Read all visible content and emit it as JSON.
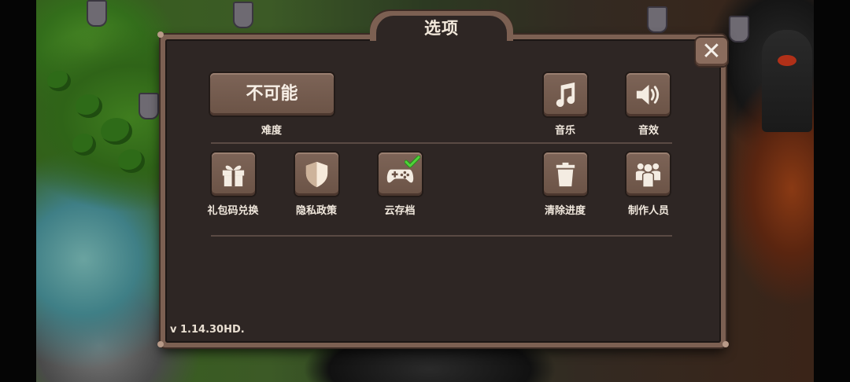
{
  "dialog": {
    "title": "选项",
    "version": "v 1.14.30HD."
  },
  "difficulty": {
    "value": "不可能",
    "label": "难度"
  },
  "audio": {
    "music_label": "音乐",
    "sound_label": "音效"
  },
  "buttons": [
    {
      "label": "礼包码兑换",
      "icon": "gift-icon"
    },
    {
      "label": "隐私政策",
      "icon": "shield-icon"
    },
    {
      "label": "云存档",
      "icon": "gamepad-check-icon"
    },
    {
      "label": "清除进度",
      "icon": "trash-icon"
    },
    {
      "label": "制作人员",
      "icon": "people-icon"
    }
  ],
  "colors": {
    "panel": "#2e2624",
    "frame": "#7c6052",
    "button": "#6b5346",
    "check": "#3fbf2a",
    "text": "#f1e8dd"
  }
}
